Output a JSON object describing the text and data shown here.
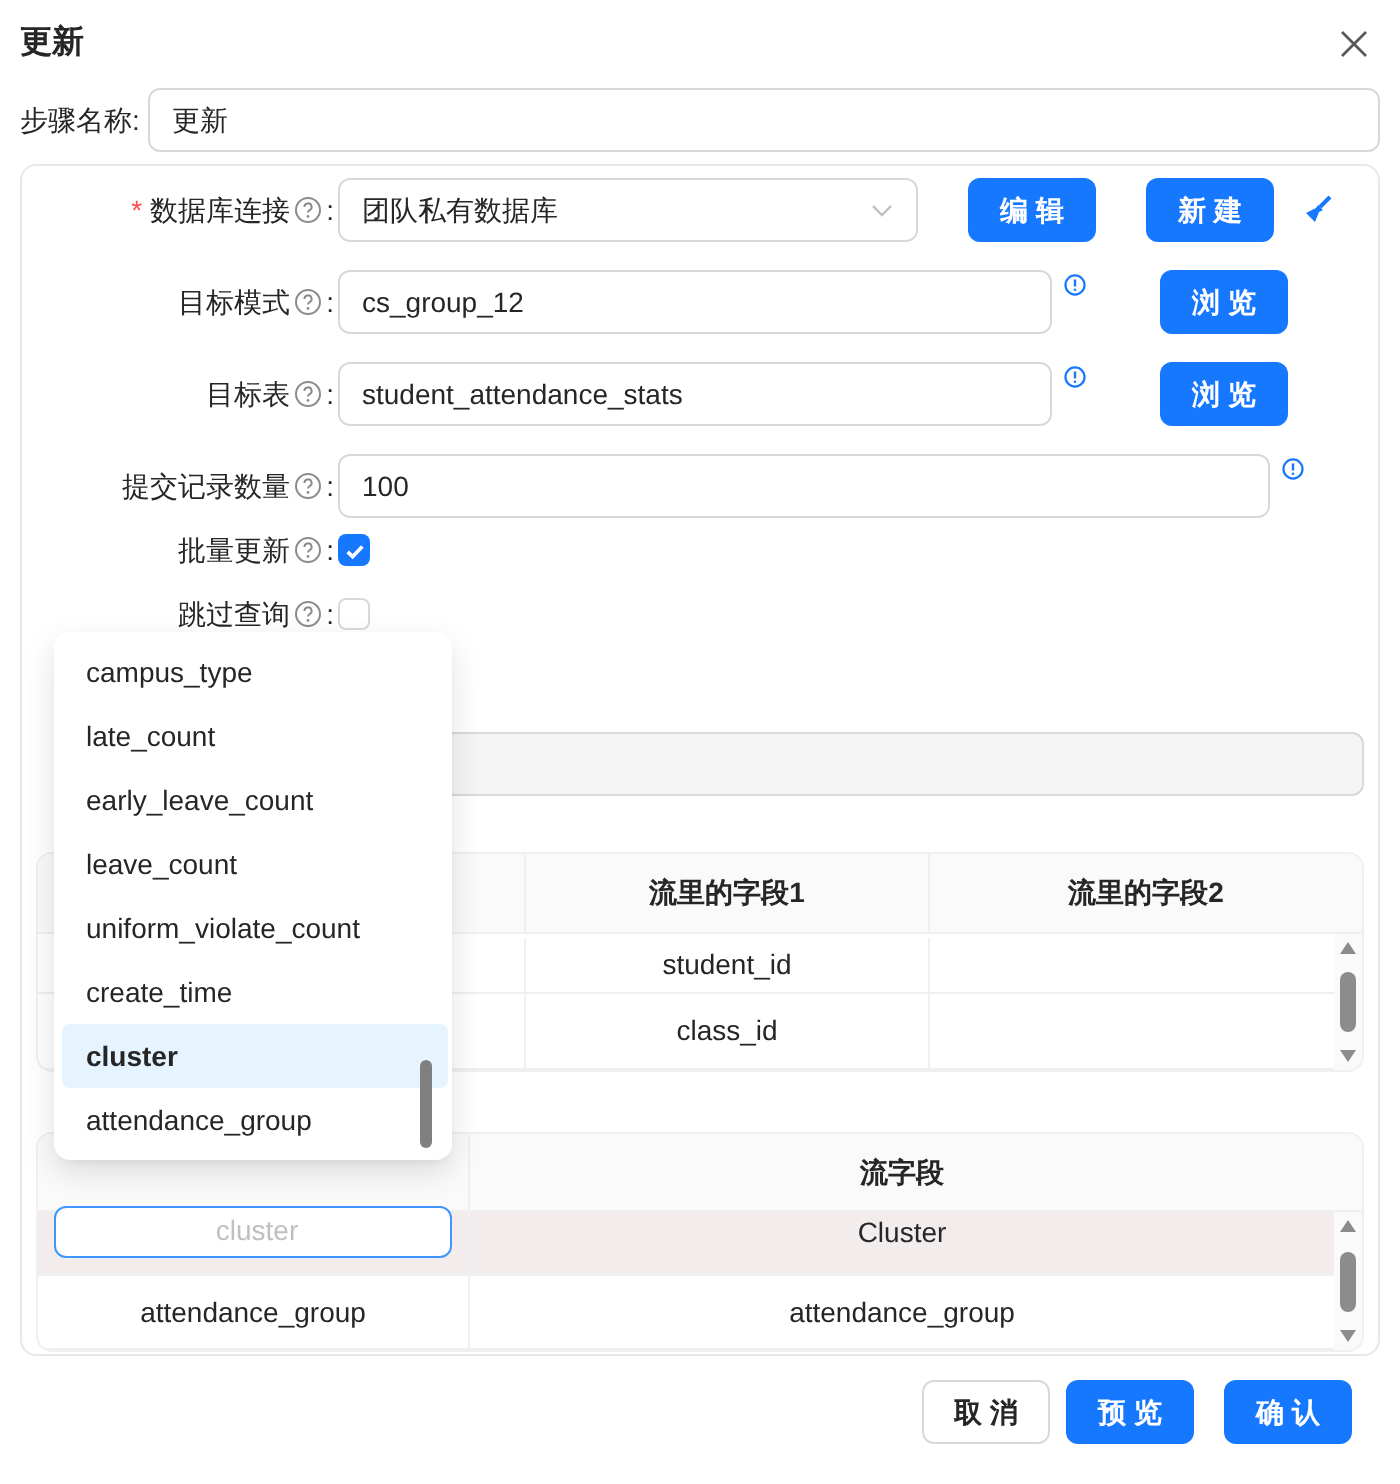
{
  "dialog": {
    "title": "更新"
  },
  "step_name": {
    "label": "步骤名称:",
    "value": "更新"
  },
  "form": {
    "fields": [
      {
        "kind": "select",
        "required_mark": "*",
        "label": "数据库连接",
        "suffix": ":",
        "value": "团队私有数据库",
        "info_icon": false,
        "buttons": [
          "编 辑",
          "新 建"
        ],
        "tool_icon": true
      },
      {
        "kind": "input",
        "label": "目标模式",
        "suffix": ":",
        "value": "cs_group_12",
        "info_icon": true,
        "buttons": [
          "浏 览"
        ],
        "tool_icon": false
      },
      {
        "kind": "input",
        "label": "目标表",
        "suffix": ":",
        "value": "student_attendance_stats",
        "info_icon": true,
        "buttons": [
          "浏 览"
        ],
        "tool_icon": false
      },
      {
        "kind": "input",
        "label": "提交记录数量",
        "suffix": ":",
        "value": "100",
        "info_icon": true,
        "tool_icon": false
      },
      {
        "kind": "checkbox",
        "label": "批量更新",
        "suffix": ":",
        "checked": true
      },
      {
        "kind": "checkbox",
        "label": "跳过查询",
        "suffix": ":",
        "checked": false
      }
    ]
  },
  "lookup_table": {
    "columns": [
      {
        "label": "流里的字段1"
      },
      {
        "label": "流里的字段2"
      }
    ],
    "rows": [
      {
        "field1": "student_id"
      },
      {
        "field1": "class_id"
      }
    ]
  },
  "update_table": {
    "columns": [
      {
        "label": "流字段"
      }
    ],
    "rows": [
      {
        "editing": true,
        "placeholder": "cluster",
        "stream_field": "Cluster"
      },
      {
        "editing": false,
        "table_field": "attendance_group",
        "stream_field": "attendance_group"
      }
    ]
  },
  "dropdown": {
    "options": [
      {
        "label": "campus_type",
        "selected": false
      },
      {
        "label": "late_count",
        "selected": false
      },
      {
        "label": "early_leave_count",
        "selected": false
      },
      {
        "label": "leave_count",
        "selected": false
      },
      {
        "label": "uniform_violate_count",
        "selected": false
      },
      {
        "label": "create_time",
        "selected": false
      },
      {
        "label": "cluster",
        "selected": true
      },
      {
        "label": "attendance_group",
        "selected": false
      }
    ]
  },
  "footer": {
    "buttons": [
      {
        "label": "取 消",
        "kind": "default"
      },
      {
        "label": "预 览",
        "kind": "primary"
      },
      {
        "label": "确 认",
        "kind": "primary"
      }
    ]
  }
}
